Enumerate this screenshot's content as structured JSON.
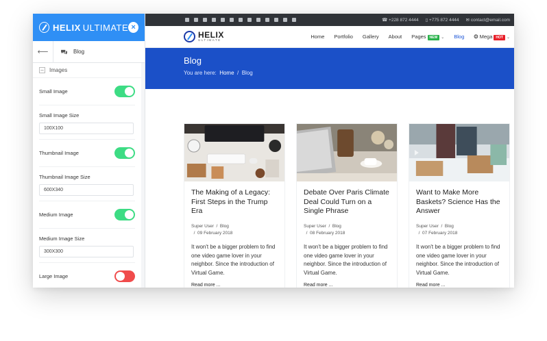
{
  "panel": {
    "brand_a": "HELIX",
    "brand_b": "ULTIMATE",
    "close": "×",
    "nav_back": "⟵",
    "nav_label": "Blog",
    "section_toggle": "–",
    "section_title": "Images",
    "options": {
      "small_image": "Small Image",
      "small_image_size": "Small Image Size",
      "small_image_size_value": "100X100",
      "thumbnail_image": "Thumbnail Image",
      "thumbnail_image_size": "Thumbnail Image Size",
      "thumbnail_image_size_value": "600X340",
      "medium_image": "Medium Image",
      "medium_image_size": "Medium Image Size",
      "medium_image_size_value": "300X300",
      "large_image": "Large Image"
    },
    "toggle_states": {
      "small_image": true,
      "thumbnail_image": true,
      "medium_image": true,
      "large_image": false
    }
  },
  "topbar": {
    "phone": "+228 872 4444",
    "mobile": "+775 872 4444",
    "email": "contact@email.com"
  },
  "site": {
    "logo_text": "HELIX",
    "logo_sub": "ULTIMATE",
    "menu": {
      "home": "Home",
      "portfolio": "Portfolio",
      "gallery": "Gallery",
      "about": "About",
      "pages": "Pages",
      "pages_badge": "NEW",
      "blog": "Blog",
      "mega": "Mega",
      "mega_badge": "HOT"
    },
    "colors": {
      "badge_new": "#2bb24c",
      "badge_hot": "#e8202a",
      "hero": "#1b50c8",
      "accent": "#2f8ff5"
    }
  },
  "hero": {
    "title": "Blog",
    "crumb_prefix": "You are here:",
    "crumb_home": "Home",
    "crumb_sep": "/",
    "crumb_current": "Blog"
  },
  "cards": [
    {
      "title": "The Making of a Legacy: First Steps in the Trump Era",
      "author": "Super User",
      "category": "Blog",
      "date": "09 February 2018",
      "excerpt": "It won't be a bigger problem to find one video game lover in your neighbor. Since the introduction of Virtual Game.",
      "more": "Read more ..."
    },
    {
      "title": "Debate Over Paris Climate Deal Could Turn on a Single Phrase",
      "author": "Super User",
      "category": "Blog",
      "date": "08 February 2018",
      "excerpt": "It won't be a bigger problem to find one video game lover in your neighbor. Since the introduction of Virtual Game.",
      "more": "Read more ..."
    },
    {
      "title": "Want to Make More Baskets? Science Has the Answer",
      "author": "Super User",
      "category": "Blog",
      "date": "07 February 2018",
      "excerpt": "It won't be a bigger problem to find one video game lover in your neighbor. Since the introduction of Virtual Game.",
      "more": "Read more ..."
    }
  ]
}
